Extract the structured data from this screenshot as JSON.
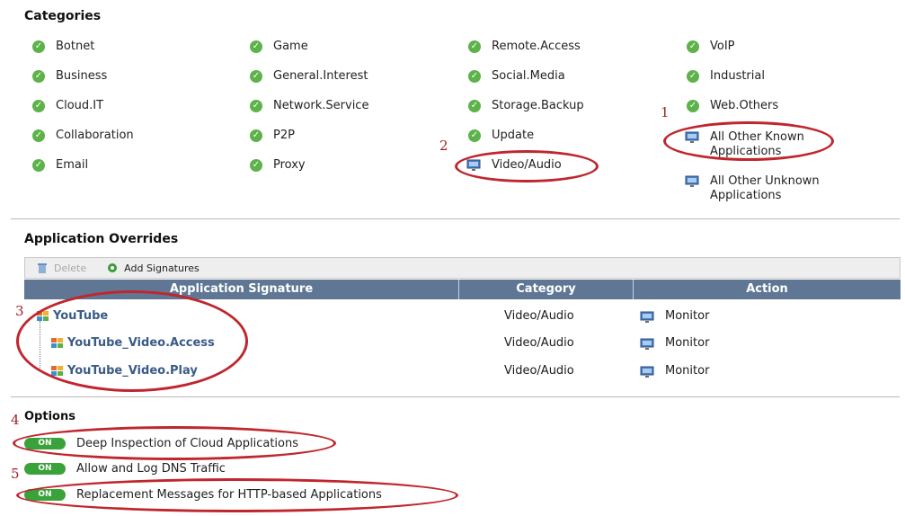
{
  "categories": {
    "title": "Categories",
    "items": [
      {
        "label": "Botnet",
        "icon": "check-icon"
      },
      {
        "label": "Business",
        "icon": "check-icon"
      },
      {
        "label": "Cloud.IT",
        "icon": "check-icon"
      },
      {
        "label": "Collaboration",
        "icon": "check-icon"
      },
      {
        "label": "Email",
        "icon": "check-icon"
      },
      {
        "label": "Game",
        "icon": "check-icon"
      },
      {
        "label": "General.Interest",
        "icon": "check-icon"
      },
      {
        "label": "Network.Service",
        "icon": "check-icon"
      },
      {
        "label": "P2P",
        "icon": "check-icon"
      },
      {
        "label": "Proxy",
        "icon": "check-icon"
      },
      {
        "label": "Remote.Access",
        "icon": "check-icon"
      },
      {
        "label": "Social.Media",
        "icon": "check-icon"
      },
      {
        "label": "Storage.Backup",
        "icon": "check-icon"
      },
      {
        "label": "Update",
        "icon": "check-icon"
      },
      {
        "label": "Video/Audio",
        "icon": "monitor-icon"
      },
      {
        "label": "VoIP",
        "icon": "check-icon"
      },
      {
        "label": "Industrial",
        "icon": "check-icon"
      },
      {
        "label": "Web.Others",
        "icon": "check-icon"
      },
      {
        "label_line1": "All Other Known",
        "label_line2": "Applications",
        "icon": "monitor-icon"
      },
      {
        "label_line1": "All Other Unknown",
        "label_line2": "Applications",
        "icon": "monitor-icon"
      }
    ]
  },
  "overrides": {
    "title": "Application Overrides",
    "toolbar": {
      "delete_label": "Delete",
      "add_label": "Add Signatures"
    },
    "columns": [
      "Application Signature",
      "Category",
      "Action"
    ],
    "rows": [
      {
        "signature": "YouTube",
        "category": "Video/Audio",
        "action": "Monitor"
      },
      {
        "signature": "YouTube_Video.Access",
        "category": "Video/Audio",
        "action": "Monitor"
      },
      {
        "signature": "YouTube_Video.Play",
        "category": "Video/Audio",
        "action": "Monitor"
      }
    ]
  },
  "options": {
    "title": "Options",
    "toggle_label": "ON",
    "items": [
      {
        "label": "Deep Inspection of Cloud Applications",
        "state": "ON"
      },
      {
        "label": "Allow and Log DNS Traffic",
        "state": "ON"
      },
      {
        "label": "Replacement Messages for HTTP-based Applications",
        "state": "ON"
      }
    ]
  },
  "annotations": {
    "n1": "1",
    "n2": "2",
    "n3": "3",
    "n4": "4",
    "n5": "5",
    "color": "#c0262d"
  },
  "colors": {
    "check": "#5db24a",
    "table_header": "#5f7795",
    "signature_text": "#3a5b86",
    "toggle_on": "#3aa23a"
  }
}
